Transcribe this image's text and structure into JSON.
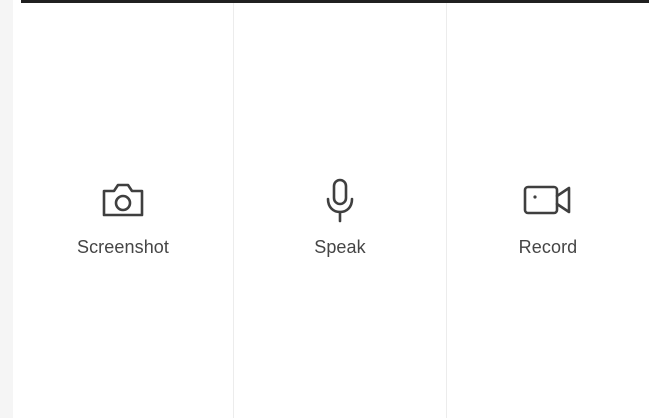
{
  "capture_options": [
    {
      "label": "Screenshot",
      "icon": "camera-icon"
    },
    {
      "label": "Speak",
      "icon": "microphone-icon"
    },
    {
      "label": "Record",
      "icon": "video-camera-icon"
    }
  ],
  "colors": {
    "text": "#454545",
    "icon": "#3f3f3f",
    "divider": "#ececec",
    "top_bar": "#202020"
  }
}
